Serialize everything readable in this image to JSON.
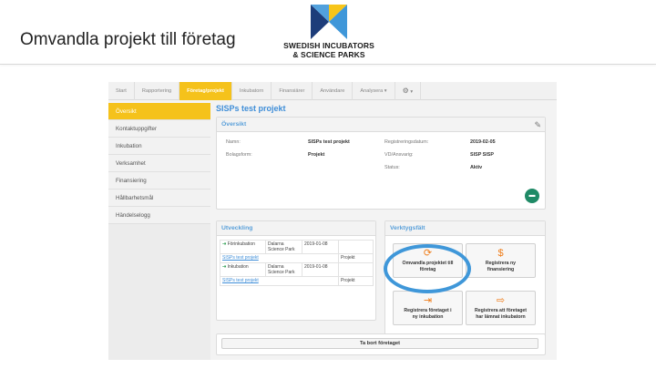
{
  "slide": {
    "title": "Omvandla projekt till företag",
    "logo_line1": "SWEDISH INCUBATORS",
    "logo_line2": "& SCIENCE PARKS",
    "logo_colors": {
      "dark_blue": "#1d3d7a",
      "light_blue": "#3f97d9",
      "yellow": "#f7c51a"
    }
  },
  "nav": {
    "tabs": [
      "Start",
      "Rapportering",
      "Företag/projekt",
      "Inkubatorn",
      "Finansiärer",
      "Användare",
      "Analysera ▾"
    ],
    "active_tab": "Företag/projekt",
    "settings_caret": "▾"
  },
  "sidebar": {
    "items": [
      "Översikt",
      "Kontaktuppgifter",
      "Inkubation",
      "Verksamhet",
      "Finansiering",
      "Hållbarhetsmål",
      "Händelselogg"
    ],
    "active_item": "Översikt"
  },
  "project": {
    "title": "SISPs test projekt"
  },
  "overview": {
    "heading": "Översikt",
    "name_label": "Namn:",
    "name_value": "SISPs test projekt",
    "form_label": "Bolagsform:",
    "form_value": "Projekt",
    "regdate_label": "Registreringsdatum:",
    "regdate_value": "2019-02-05",
    "owner_label": "VD/Ansvarig:",
    "owner_value": "SISP SISP",
    "status_label": "Status:",
    "status_value": "Aktiv"
  },
  "development": {
    "heading": "Utveckling",
    "rows": [
      {
        "type": "Förinkubation",
        "org_line1": "Dalarna",
        "org_line2": "Science Park",
        "date": "2019-01-08",
        "link": "SISPs test projekt",
        "kind": "Projekt"
      },
      {
        "type": "Inkubation",
        "org_line1": "Dalarna",
        "org_line2": "Science Park",
        "date": "2019-01-08",
        "link": "SISPs test projekt",
        "kind": "Projekt"
      }
    ]
  },
  "toolbox": {
    "heading": "Verktygsfält",
    "convert_line1": "Omvandla projektet till",
    "convert_line2": "företag",
    "funding_line1": "Registrera ny",
    "funding_line2": "finansiering",
    "incub_line1": "Registrera företaget i",
    "incub_line2": "ny inkubation",
    "left_line1": "Registrera att företaget",
    "left_line2": "har lämnat inkubatorn",
    "funding_symbol": "$"
  },
  "footer": {
    "delete_label": "Ta bort företaget"
  },
  "colors": {
    "accent_yellow": "#f5c21b",
    "link_blue": "#3f8ed8",
    "tool_orange": "#ef7d1a",
    "highlight_ring": "#3f97d9",
    "folder_green": "#1f8a66"
  }
}
